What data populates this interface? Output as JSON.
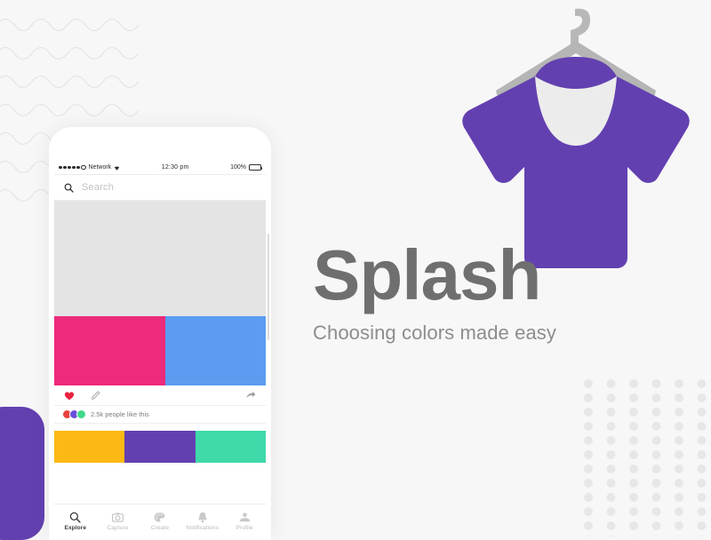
{
  "canvas": {
    "background": "#f7f7f7"
  },
  "branding": {
    "title": "Splash",
    "tagline": "Choosing colors made easy",
    "title_color": "#6f6f6f",
    "tagline_color": "#8d8d8d"
  },
  "decorations": {
    "wave_lines": {
      "name": "wave-lines",
      "color": "#e2e2e2",
      "count": 7
    },
    "dot_grid": {
      "name": "dot-grid",
      "color": "#e6e6e6",
      "columns": 6,
      "rows": 11
    },
    "purple_blob": {
      "name": "purple-blob",
      "color": "#6340b0"
    }
  },
  "tshirt": {
    "shirt_color": "#6340b0",
    "hanger_color": "#b5b5b5",
    "neck_color": "#ececec"
  },
  "phone": {
    "status_bar": {
      "carrier": "Network",
      "time": "12:30 pm",
      "battery_percent": "100%",
      "signal_dots_filled": 5,
      "signal_dots_empty": 1,
      "battery_color": "#3ed23e"
    },
    "search": {
      "placeholder": "Search",
      "icon": "search-icon"
    },
    "hero": {
      "type": "image-placeholder",
      "color": "#e4e4e4"
    },
    "swatch_row_1": [
      {
        "name": "swatch-pink",
        "color": "#ed2a7b"
      },
      {
        "name": "swatch-blue",
        "color": "#5b9bf0"
      }
    ],
    "swatch_row_2": [
      {
        "name": "swatch-yellow",
        "color": "#fdb913"
      },
      {
        "name": "swatch-purple",
        "color": "#6340b0"
      },
      {
        "name": "swatch-teal",
        "color": "#3fd9aa"
      }
    ],
    "actions": [
      {
        "name": "like-icon",
        "icon": "heart",
        "color": "#e8233f"
      },
      {
        "name": "edit-icon",
        "icon": "pencil",
        "color": "#9a9a9a"
      },
      {
        "name": "share-icon",
        "icon": "share-arrow",
        "color": "#9a9a9a"
      }
    ],
    "likes": {
      "text": "2.5k people like this",
      "avatars": [
        "#e8433f",
        "#6a4fd8",
        "#3fd98a"
      ]
    },
    "tabs": [
      {
        "label": "Explore",
        "icon": "search-icon",
        "active": true
      },
      {
        "label": "Capture",
        "icon": "camera-icon",
        "active": false
      },
      {
        "label": "Create",
        "icon": "palette-icon",
        "active": false
      },
      {
        "label": "Notifications",
        "icon": "bell-icon",
        "active": false
      },
      {
        "label": "Profile",
        "icon": "person-icon",
        "active": false
      }
    ]
  }
}
